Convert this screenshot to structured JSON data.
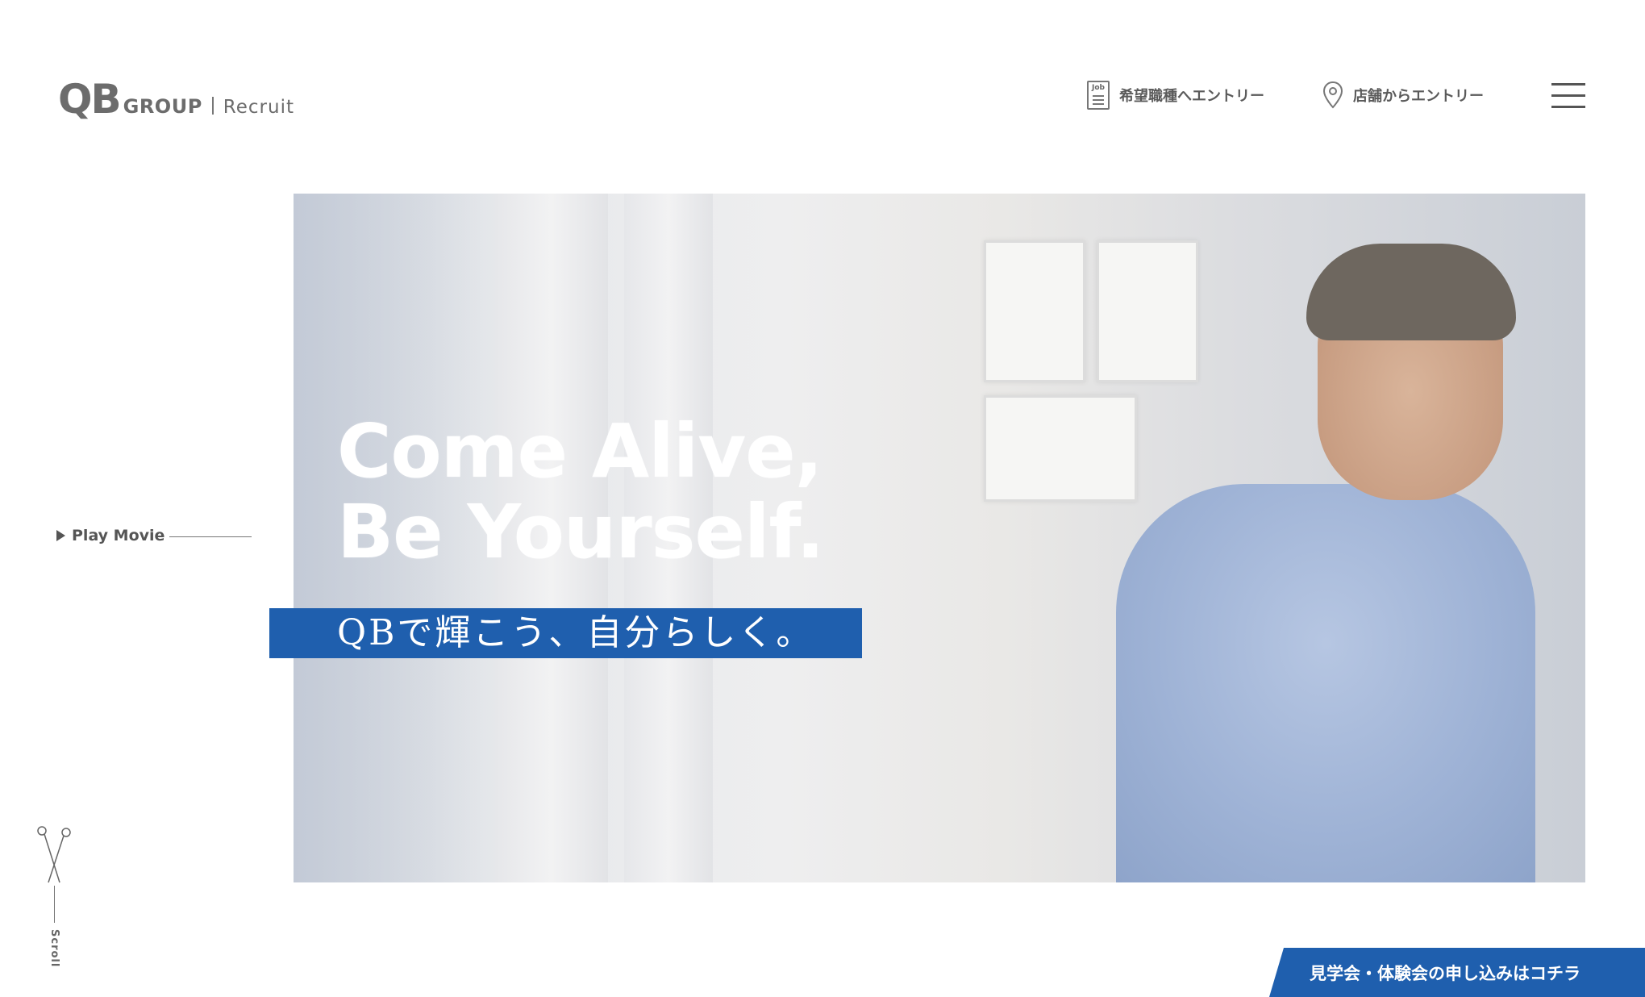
{
  "header": {
    "logo_qb": "QB",
    "logo_group": "GROUP",
    "logo_recruit": "Recruit",
    "nav": [
      {
        "label": "希望職種へエントリー",
        "icon": "job-icon",
        "icon_text": "Job"
      },
      {
        "label": "店舗からエントリー",
        "icon": "map-pin-icon"
      }
    ],
    "menu_icon": "hamburger-icon"
  },
  "hero": {
    "headline_line1": "Come Alive,",
    "headline_line2": "Be Yourself.",
    "tagline": "QBで輝こう、自分らしく。",
    "tagline_bg": "#1f5fae"
  },
  "play_movie": {
    "label": "Play Movie",
    "icon": "play-icon"
  },
  "scroll": {
    "label": "Scroll",
    "icon": "scissors-icon"
  },
  "cta": {
    "label": "見学会・体験会の申し込みはコチラ",
    "color": "#1f5fae"
  }
}
